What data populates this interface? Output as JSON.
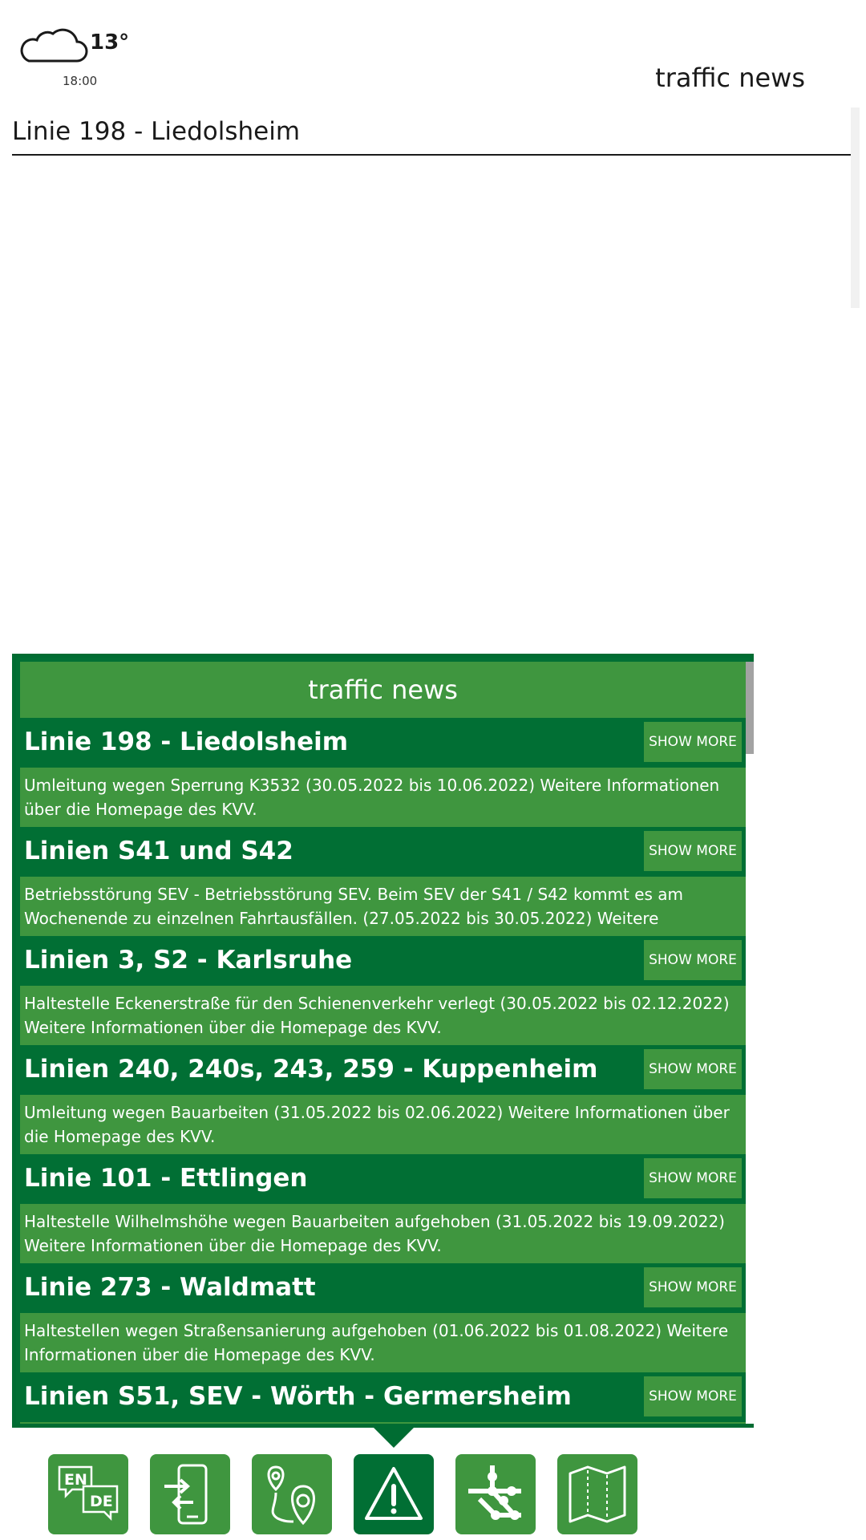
{
  "header": {
    "weather": {
      "icon": "cloud-icon",
      "temperature": "13°",
      "time": "18:00"
    },
    "title": "traffic news"
  },
  "detail": {
    "title": "Linie 198 - Liedolsheim"
  },
  "panel": {
    "title": "traffic news",
    "items": [
      {
        "title": "Linie 198 - Liedolsheim",
        "button": "SHOW MORE",
        "text": "Umleitung wegen Sperrung K3532 (30.05.2022 bis 10.06.2022) Weitere Informationen über die Homepage des KVV."
      },
      {
        "title": "Linien S41 und S42",
        "button": "SHOW MORE",
        "text": "Betriebsstörung SEV - Betriebsstörung SEV. Beim SEV der S41 / S42 kommt es am Wochenende zu einzelnen Fahrtausfällen. (27.05.2022 bis 30.05.2022) Weitere"
      },
      {
        "title": "Linien 3, S2 - Karlsruhe",
        "button": "SHOW MORE",
        "text": "Haltestelle Eckenerstraße für den Schienenverkehr verlegt (30.05.2022 bis 02.12.2022) Weitere Informationen über die Homepage des KVV."
      },
      {
        "title": "Linien 240, 240s, 243, 259 - Kuppenheim",
        "button": "SHOW MORE",
        "text": "Umleitung wegen Bauarbeiten (31.05.2022 bis 02.06.2022) Weitere Informationen über die Homepage des KVV."
      },
      {
        "title": "Linie 101 - Ettlingen",
        "button": "SHOW MORE",
        "text": "Haltestelle Wilhelmshöhe wegen Bauarbeiten aufgehoben (31.05.2022 bis 19.09.2022) Weitere Informationen über die Homepage des KVV."
      },
      {
        "title": "Linie 273 - Waldmatt",
        "button": "SHOW MORE",
        "text": "Haltestellen wegen Straßensanierung aufgehoben (01.06.2022 bis 01.08.2022) Weitere Informationen über die Homepage des KVV."
      },
      {
        "title": "Linien S51, SEV - Wörth - Germersheim",
        "button": "SHOW MORE",
        "text": ""
      }
    ]
  },
  "nav": {
    "items": [
      {
        "name": "language",
        "icon": "language-icon",
        "labels": [
          "EN",
          "DE"
        ],
        "active": false
      },
      {
        "name": "checkin",
        "icon": "phone-checkin-icon",
        "active": false
      },
      {
        "name": "route",
        "icon": "route-pin-icon",
        "active": false
      },
      {
        "name": "traffic-news",
        "icon": "warning-icon",
        "active": true
      },
      {
        "name": "network",
        "icon": "network-icon",
        "active": false
      },
      {
        "name": "map",
        "icon": "map-icon",
        "active": false
      }
    ]
  },
  "colors": {
    "dark_green": "#016f34",
    "light_green": "#3f963f",
    "text": "#1a1a1a"
  }
}
